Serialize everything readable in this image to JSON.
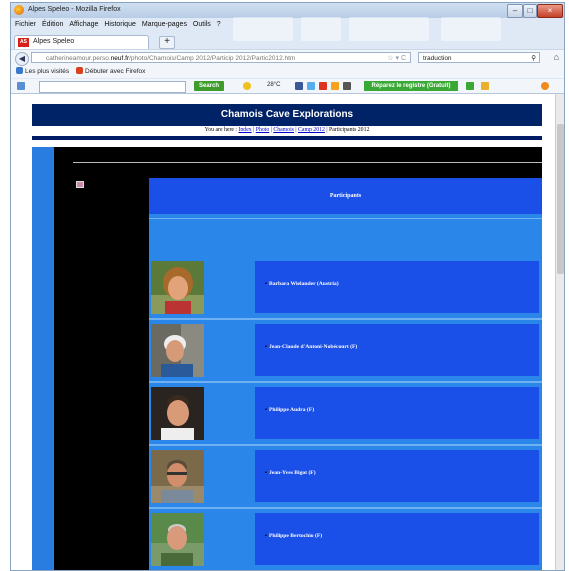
{
  "window": {
    "title": "Alpes Speleo - Mozilla Firefox",
    "buttons": {
      "minimize": "–",
      "maximize": "□",
      "close": "×"
    }
  },
  "menu": [
    "Fichier",
    "Édition",
    "Affichage",
    "Historique",
    "Marque-pages",
    "Outils",
    "?"
  ],
  "tab": {
    "label": "Alpes Speleo",
    "new_tab": "+"
  },
  "navigation": {
    "url_prefix": "catherineamour.perso.",
    "url_domain": "neuf.fr",
    "url_suffix": "/photo/Chamois/Camp 2012/Particip 2012/Partic2012.htm",
    "search_value": "traduction"
  },
  "bookmarks": [
    {
      "label": "Les plus visités",
      "color": "#3a78c9"
    },
    {
      "label": "Débuter avec Firefox",
      "color": "#d8401e"
    }
  ],
  "toolbar": {
    "search_button": "Search",
    "temperature": "28°C",
    "repair_button": "Réparez le registre (Gratuit)"
  },
  "page": {
    "banner": "Chamois Cave Explorations",
    "breadcrumb": {
      "prefix": "You are here :",
      "links": [
        "Index",
        "Photo",
        "Chamois",
        "Camp 2012"
      ],
      "current": "Participants 2012"
    },
    "table_header": "Participants",
    "participants": [
      {
        "name": "Barbara Wielander (Austria)"
      },
      {
        "name": "Jean-Claude d'Antoni-Nobécourt (F)"
      },
      {
        "name": "Philippe Audra (F)"
      },
      {
        "name": "Jean-Yves Bigot (F)"
      },
      {
        "name": "Philippe Bertochio (F)"
      }
    ]
  },
  "colors": {
    "banner": "#002266",
    "table_light": "#2a86e8",
    "table_dark": "#1a4fe8",
    "page_bg": "#000000",
    "left_strip": "#2a7de0"
  }
}
